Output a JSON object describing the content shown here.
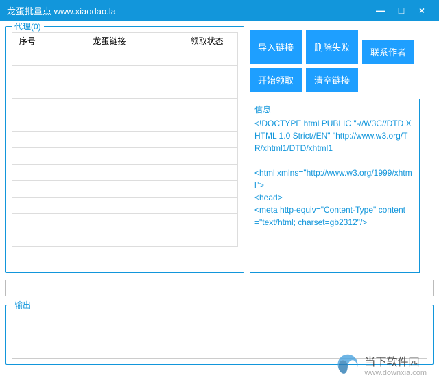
{
  "titlebar": {
    "title": "龙蛋批量点 www.xiaodao.la"
  },
  "proxy": {
    "legend": "代理(0)",
    "columns": [
      "序号",
      "龙蛋链接",
      "领取状态"
    ],
    "row_count": 12
  },
  "buttons": {
    "import": "导入链接",
    "delete_failed": "删除失败",
    "start": "开始领取",
    "clear": "清空链接",
    "contact": "联系作者"
  },
  "info": {
    "label": "信息",
    "lines": [
      "<!DOCTYPE html PUBLIC \"-//W3C//DTD XHTML 1.0 Strict//EN\" \"http://www.w3.org/TR/xhtml1/DTD/xhtml1",
      "",
      "<html xmlns=\"http://www.w3.org/1999/xhtml\">",
      "<head>",
      "<meta http-equiv=\"Content-Type\" content=\"text/html; charset=gb2312\"/>"
    ]
  },
  "output": {
    "legend": "输出"
  },
  "watermark": {
    "cn": "当下软件园",
    "url": "www.downxia.com"
  }
}
